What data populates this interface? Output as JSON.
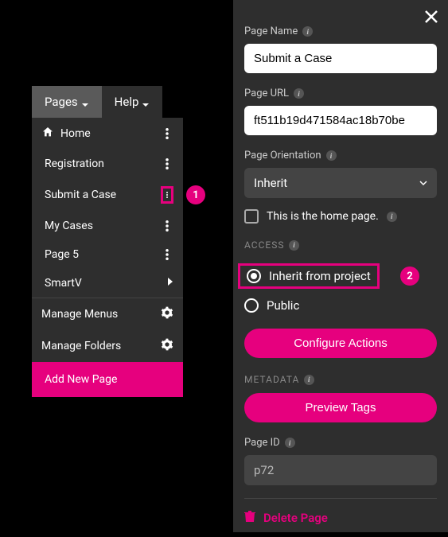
{
  "tabs": {
    "pages": "Pages",
    "help": "Help"
  },
  "menu": {
    "home": "Home",
    "registration": "Registration",
    "submitCase": "Submit a Case",
    "myCases": "My Cases",
    "page5": "Page 5",
    "smartv": "SmartV",
    "manageMenus": "Manage Menus",
    "manageFolders": "Manage Folders",
    "addNew": "Add New Page"
  },
  "callouts": {
    "one": "1",
    "two": "2"
  },
  "form": {
    "pageNameLabel": "Page Name",
    "pageNameValue": "Submit a Case",
    "pageUrlLabel": "Page URL",
    "pageUrlValue": "ft511b19d471584ac18b70be",
    "orientationLabel": "Page Orientation",
    "orientationValue": "Inherit",
    "homePageLabel": "This is the home page.",
    "accessHeader": "ACCESS",
    "inheritOption": "Inherit from project",
    "publicOption": "Public",
    "configureActions": "Configure Actions",
    "metadataHeader": "METADATA",
    "previewTags": "Preview Tags",
    "pageIdLabel": "Page ID",
    "pageIdValue": "p72",
    "deletePage": "Delete Page"
  }
}
